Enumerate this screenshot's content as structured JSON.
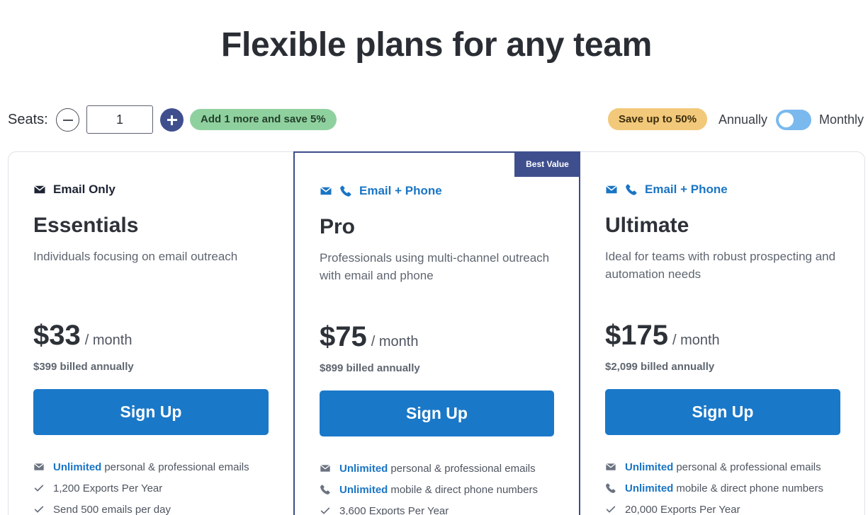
{
  "page": {
    "title": "Flexible plans for any team"
  },
  "seats": {
    "label": "Seats:",
    "value": "1",
    "promo": "Add 1 more and save 5%"
  },
  "billing": {
    "save_badge": "Save up to 50%",
    "annually_label": "Annually",
    "monthly_label": "Monthly",
    "toggle_state": "annually"
  },
  "colors": {
    "accent_blue": "#1a78c8",
    "navy": "#3f4f8e",
    "promo_green": "#8fd19e",
    "save_yellow": "#f2c97a"
  },
  "plans": [
    {
      "channel_label": "Email Only",
      "channel_icons": [
        "envelope-icon"
      ],
      "name": "Essentials",
      "description": "Individuals focusing on email outreach",
      "price": "$33",
      "period": "/ month",
      "billed": "$399 billed annually",
      "cta": "Sign Up",
      "features": [
        {
          "icon": "envelope-icon",
          "highlight": "Unlimited",
          "text": "personal & professional emails"
        },
        {
          "icon": "check-icon",
          "highlight": "",
          "text": "1,200 Exports Per Year"
        },
        {
          "icon": "check-icon",
          "highlight": "",
          "text": "Send 500 emails per day"
        }
      ]
    },
    {
      "badge": "Best Value",
      "channel_label": "Email + Phone",
      "channel_icons": [
        "envelope-icon",
        "phone-icon"
      ],
      "name": "Pro",
      "description": "Professionals using multi-channel outreach with email and phone",
      "price": "$75",
      "period": "/ month",
      "billed": "$899 billed annually",
      "cta": "Sign Up",
      "features": [
        {
          "icon": "envelope-icon",
          "highlight": "Unlimited",
          "text": "personal & professional emails"
        },
        {
          "icon": "phone-icon",
          "highlight": "Unlimited",
          "text": "mobile & direct phone numbers"
        },
        {
          "icon": "check-icon",
          "highlight": "",
          "text": "3,600 Exports Per Year"
        }
      ]
    },
    {
      "channel_label": "Email + Phone",
      "channel_icons": [
        "envelope-icon",
        "phone-icon"
      ],
      "name": "Ultimate",
      "description": "Ideal for teams with robust prospecting and automation needs",
      "price": "$175",
      "period": "/ month",
      "billed": "$2,099 billed annually",
      "cta": "Sign Up",
      "features": [
        {
          "icon": "envelope-icon",
          "highlight": "Unlimited",
          "text": "personal & professional emails"
        },
        {
          "icon": "phone-icon",
          "highlight": "Unlimited",
          "text": "mobile & direct phone numbers"
        },
        {
          "icon": "check-icon",
          "highlight": "",
          "text": "20,000 Exports Per Year"
        }
      ]
    }
  ]
}
